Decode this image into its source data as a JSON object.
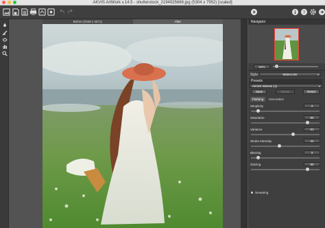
{
  "window": {
    "title": "AKVIS ArtWork v.14.5 - shutterstock_2194925669.jpg (5304 x 7952) [scaled]"
  },
  "canvas": {
    "tab_before": "Before (2049 x 3071)",
    "tab_after": "After"
  },
  "navigator": {
    "header": "Navigator",
    "zoom_value": "53%"
  },
  "settings": {
    "style_label": "Style:",
    "style_value": "Watercolor",
    "presets_header": "Presets",
    "preset_value": "AKVIS Intense (1)",
    "save_label": "Save",
    "delete_label": "Delete",
    "reset_label": "Reset",
    "tab_painting": "Painting",
    "tab_decoration": "Decoration",
    "params": [
      {
        "label": "Simplicity",
        "value": "3",
        "level": 0.1
      },
      {
        "label": "Saturation",
        "value": "82",
        "level": 0.82
      },
      {
        "label": "Variance",
        "value": "61",
        "level": 0.61
      },
      {
        "label": "Stroke Intensity",
        "value": "41",
        "level": 0.41
      },
      {
        "label": "Blurring",
        "value": "3",
        "level": 0.1
      },
      {
        "label": "Glazing",
        "value": "82",
        "level": 0.82
      }
    ],
    "smearing_label": "Smearing",
    "smearing_checked": true
  },
  "colors": {
    "close": "#ff5f57",
    "minimize": "#febc2e",
    "maximize": "#28c840",
    "panel_bg": "#3f3f3f",
    "navigator_frame": "#ff3b2f"
  },
  "icons": {
    "toolbar_left": [
      "open-image-icon",
      "save-icon",
      "print-icon",
      "batch-icon",
      "undo-icon",
      "redo-icon"
    ],
    "toolbar_right": [
      "run-icon",
      "info-icon",
      "help-icon",
      "settings-icon",
      "share-icon"
    ],
    "tools": [
      "brush-icon",
      "eraser-icon",
      "stroke-direction-icon",
      "hand-icon",
      "zoom-icon"
    ]
  }
}
